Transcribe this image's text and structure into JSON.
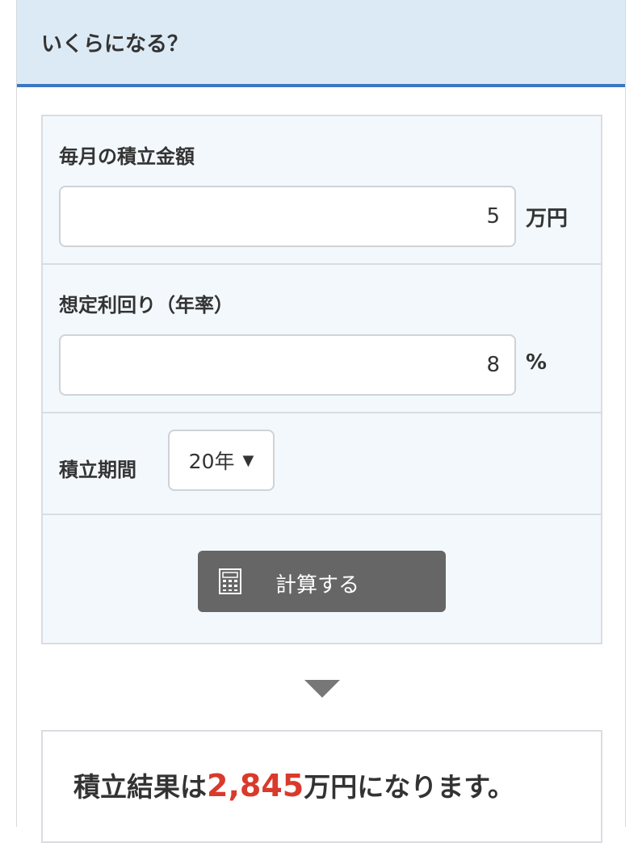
{
  "header": {
    "title": "いくらになる？"
  },
  "monthly": {
    "label": "毎月の積立金額",
    "value": "5",
    "unit": "万円"
  },
  "rate": {
    "label": "想定利回り（年率）",
    "value": "8",
    "unit": "%"
  },
  "period": {
    "label": "積立期間",
    "selected": "20年",
    "arrow": "▼"
  },
  "calculate": {
    "label": "計算する",
    "icon": "calculator-icon"
  },
  "result": {
    "prefix": "積立結果は",
    "value": "2,845",
    "suffix": "万円になります。"
  },
  "colors": {
    "accent": "#3a78c3",
    "header_bg": "#dceaf5",
    "result_value": "#d93a2b",
    "button_bg": "#666666"
  }
}
